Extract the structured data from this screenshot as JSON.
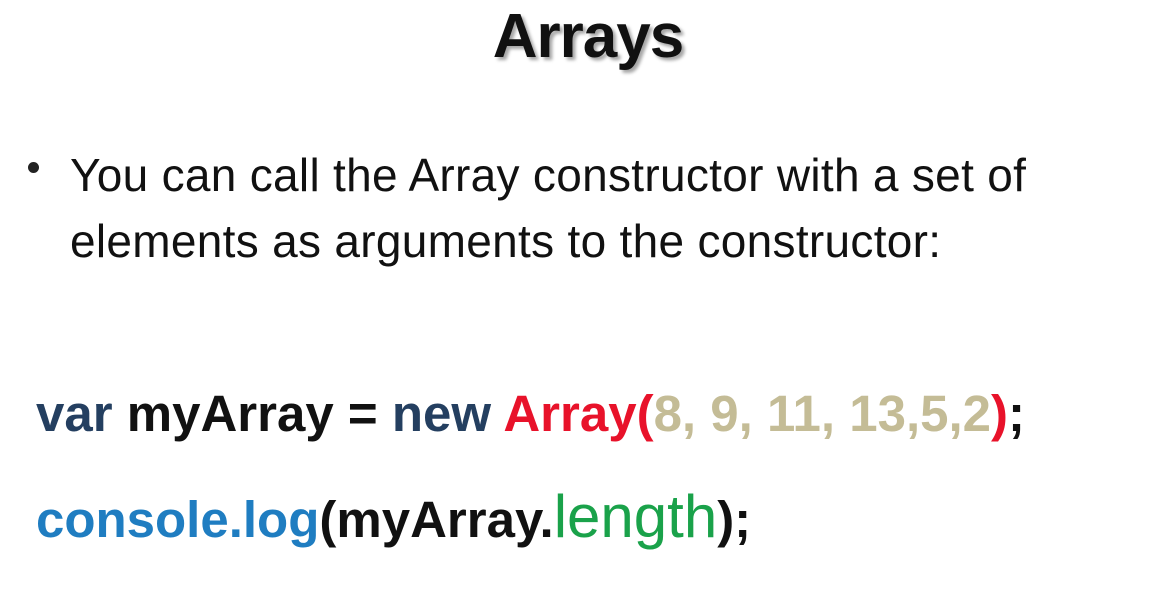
{
  "slide": {
    "title": "Arrays",
    "bullet": "You can call the Array constructor with a set of elements as arguments to the constructor:"
  },
  "code": {
    "line1": [
      {
        "text": "var",
        "color": "#243f60"
      },
      {
        "text": " myArray = ",
        "color": "#111111"
      },
      {
        "text": "new",
        "color": "#243f60"
      },
      {
        "text": " ",
        "color": "#111111"
      },
      {
        "text": "Array(",
        "color": "#e8122a"
      },
      {
        "text": "8, 9, 11, 13,5,2",
        "color": "#c4bc96"
      },
      {
        "text": ")",
        "color": "#e8122a"
      },
      {
        "text": ";",
        "color": "#111111"
      }
    ],
    "line2": [
      {
        "text": "console.log",
        "color": "#1f7dc1"
      },
      {
        "text": "(myArray.",
        "color": "#111111"
      },
      {
        "text": "length",
        "color": "#1aa24a"
      },
      {
        "text": ");",
        "color": "#111111"
      }
    ]
  }
}
